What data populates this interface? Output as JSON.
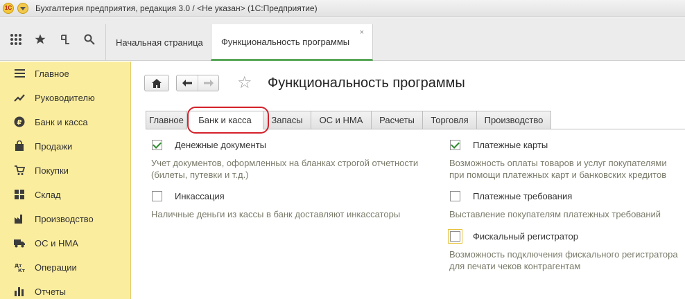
{
  "app": {
    "logo_text": "1C",
    "title": "Бухгалтерия предприятия, редакция 3.0 / <Не указан>  (1С:Предприятие)"
  },
  "toolbar": {
    "icons": [
      "apps-grid-icon",
      "favorites-star-icon",
      "history-icon",
      "search-icon"
    ]
  },
  "open_tabs": {
    "home": "Начальная страница",
    "current": "Функциональность программы",
    "close": "×"
  },
  "sidebar": {
    "items": [
      {
        "label": "Главное",
        "icon": "menu-lines-icon"
      },
      {
        "label": "Руководителю",
        "icon": "trend-chart-icon"
      },
      {
        "label": "Банк и касса",
        "icon": "ruble-coin-icon"
      },
      {
        "label": "Продажи",
        "icon": "shopping-bag-icon"
      },
      {
        "label": "Покупки",
        "icon": "shopping-cart-icon"
      },
      {
        "label": "Склад",
        "icon": "warehouse-boxes-icon"
      },
      {
        "label": "Производство",
        "icon": "factory-icon"
      },
      {
        "label": "ОС и НМА",
        "icon": "truck-icon"
      },
      {
        "label": "Операции",
        "icon": "debit-credit-icon"
      },
      {
        "label": "Отчеты",
        "icon": "bar-chart-icon"
      }
    ]
  },
  "page": {
    "title": "Функциональность программы"
  },
  "tabs": [
    {
      "label": "Главное",
      "active": false
    },
    {
      "label": "Банк и касса",
      "active": true
    },
    {
      "label": "Запасы",
      "active": false
    },
    {
      "label": "ОС и НМА",
      "active": false
    },
    {
      "label": "Расчеты",
      "active": false
    },
    {
      "label": "Торговля",
      "active": false
    },
    {
      "label": "Производство",
      "active": false
    }
  ],
  "options": {
    "left": [
      {
        "label": "Денежные документы",
        "checked": true,
        "description": [
          "Учет документов, оформленных на бланках строгой отчетности",
          "(билеты, путевки и т.д.)"
        ]
      },
      {
        "label": "Инкассация",
        "checked": false,
        "description": [
          "Наличные деньги из кассы в банк доставляют инкассаторы"
        ]
      }
    ],
    "right": [
      {
        "label": "Платежные карты",
        "checked": true,
        "description": [
          "Возможность оплаты товаров и услуг покупателями",
          "при помощи платежных карт и банковских кредитов"
        ]
      },
      {
        "label": "Платежные требования",
        "checked": false,
        "description": [
          "Выставление покупателям платежных требований"
        ]
      },
      {
        "label": "Фискальный регистратор",
        "checked": false,
        "description": [
          "Возможность подключения фискального регистратора",
          "для печати чеков контрагентам"
        ]
      }
    ]
  },
  "colors": {
    "sidebar_bg": "#fbed9e",
    "active_tab_underline": "#57a657",
    "highlight": "#d4212a",
    "check": "#2b8a2b"
  }
}
